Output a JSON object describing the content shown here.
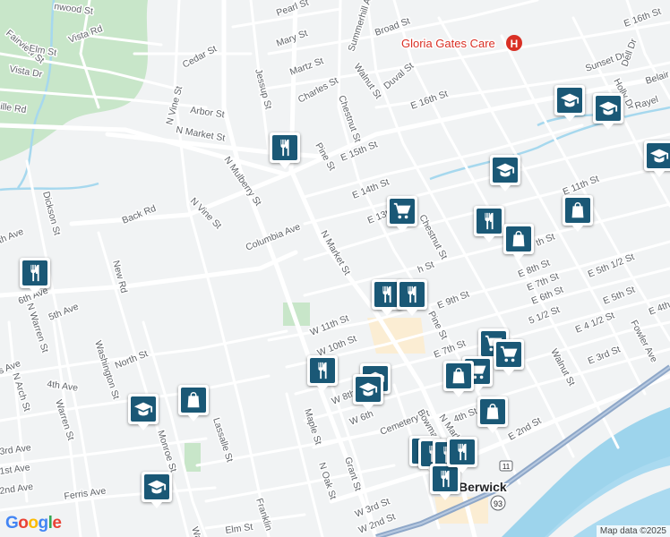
{
  "colors": {
    "land": "#f1f3f4",
    "park": "#c8e6c9",
    "water": "#a6d8ee",
    "river": "#9dd4ec",
    "road": "#ffffff",
    "highway": "#8ea7c8",
    "urban": "#fbedd3",
    "marker": "#1a5876",
    "poi_red": "#d93025"
  },
  "poi": {
    "label": "Gloria Gates Care",
    "icon": "hospital-icon"
  },
  "city": {
    "label": "Berwick"
  },
  "route_shield": {
    "label": "93"
  },
  "route_shield_small": {
    "label": "11"
  },
  "street_labels": [
    "nwood St",
    "Pearl St",
    "Fairview St",
    "Vista Rd",
    "Elm St",
    "Vista Dr",
    "Cedar St",
    "Mary St",
    "Summerhill Ave",
    "Broad St",
    "E 16th St",
    "Martz St",
    "Charles St",
    "Duval St",
    "Walnut St",
    "Sunset Dr",
    "Dell Dr",
    "E 16th St",
    "Holly Dr",
    "Belair",
    "Rayel",
    "ille Rd",
    "N Vine St",
    "Arbor St",
    "N Market St",
    "Jessup St",
    "Chestnut St",
    "E 15th St",
    "Pine St",
    "N Mulberry St",
    "E 14th St",
    "E 13th St",
    "Chestnut St",
    "E 11th St",
    "Dickson St",
    "Back Rd",
    "N Vine St",
    "Columbia Ave",
    "N Market St",
    "E 8th St",
    "th St",
    "Walnut St",
    "h St",
    "E 7th St",
    "E 5th 1/2 St",
    "E 6th St",
    "E 5th St",
    "New Rd",
    "th Ave",
    "6th Ave",
    "5th Ave",
    "N Warren St",
    "E 9th St",
    "W 11th St",
    "5 1/2 St",
    "E 4 1/2 St",
    "E 4th",
    "W 10th St",
    "Pine St",
    "E 7th St",
    "Fowler Ave",
    "E 3rd St",
    "Washington St",
    "North St",
    "s Ave",
    "4th Ave",
    "N Arch St",
    "Warren St",
    "3rd Ave",
    "Monroe St",
    "Lassalle St",
    "W 8th",
    "W 6th",
    "Maple St",
    "Cemetery St",
    "Bowman",
    "4th St",
    "N Market",
    "E 2nd St",
    "1st Ave",
    "Grant St",
    "2nd Ave",
    "Ferris Ave",
    "N Oak St",
    "Wash",
    "Franklin",
    "Elm St",
    "W 3rd St",
    "W 2nd St"
  ],
  "markers": [
    {
      "icon": "restaurant-icon"
    },
    {
      "icon": "school-icon"
    },
    {
      "icon": "school-icon"
    },
    {
      "icon": "school-icon"
    },
    {
      "icon": "school-icon"
    },
    {
      "icon": "shopping-cart-icon"
    },
    {
      "icon": "restaurant-icon"
    },
    {
      "icon": "shopping-bag-icon"
    },
    {
      "icon": "shopping-bag-icon"
    },
    {
      "icon": "restaurant-icon"
    },
    {
      "icon": "restaurant-icon"
    },
    {
      "icon": "restaurant-icon"
    },
    {
      "icon": "shopping-cart-icon"
    },
    {
      "icon": "shopping-cart-icon"
    },
    {
      "icon": "restaurant-icon"
    },
    {
      "icon": "shopping-cart-icon"
    },
    {
      "icon": "school-icon"
    },
    {
      "icon": "school-icon"
    },
    {
      "icon": "shopping-bag-icon"
    },
    {
      "icon": "shopping-bag-icon"
    },
    {
      "icon": "school-icon"
    },
    {
      "icon": "shopping-bag-icon"
    },
    {
      "icon": "shopping-bag-icon"
    },
    {
      "icon": "restaurant-icon"
    },
    {
      "icon": "restaurant-icon"
    },
    {
      "icon": "restaurant-icon"
    },
    {
      "icon": "restaurant-icon"
    },
    {
      "icon": "school-icon"
    }
  ],
  "logo": {
    "letters": [
      "G",
      "o",
      "o",
      "g",
      "l",
      "e"
    ]
  },
  "attribution": {
    "text": "Map data ©2025"
  }
}
